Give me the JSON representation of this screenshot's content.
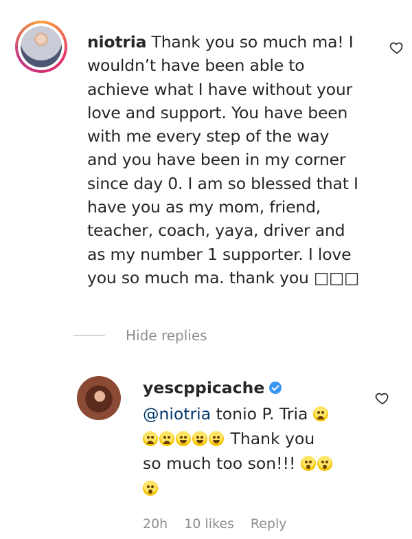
{
  "comment": {
    "username": "niotria",
    "text": " Thank you so much ma! I\nwouldn’t have been able to\nachieve what I have without your\nlove and support. You have been\nwith me every step of the way\nand you have been in my corner\nsince day 0. I am so blessed that I\nhave you as my mom, friend,\nteacher, coach, yaya, driver and\nas my number 1 supporter. I love\nyou so much ma. thank you □□□",
    "like_icon": "heart-outline-icon"
  },
  "hide_replies": {
    "label": "Hide replies"
  },
  "reply": {
    "username": "yescppicache",
    "verified_icon": "verified-badge-icon",
    "mention": "@niotria",
    "text_line1": " tonio P. Tria ",
    "text_line2": " Thank you",
    "text_line3": "so much too son!!! ",
    "like_icon": "heart-outline-icon",
    "footer": {
      "time": "20h",
      "likes": "10 likes",
      "reply": "Reply"
    }
  }
}
